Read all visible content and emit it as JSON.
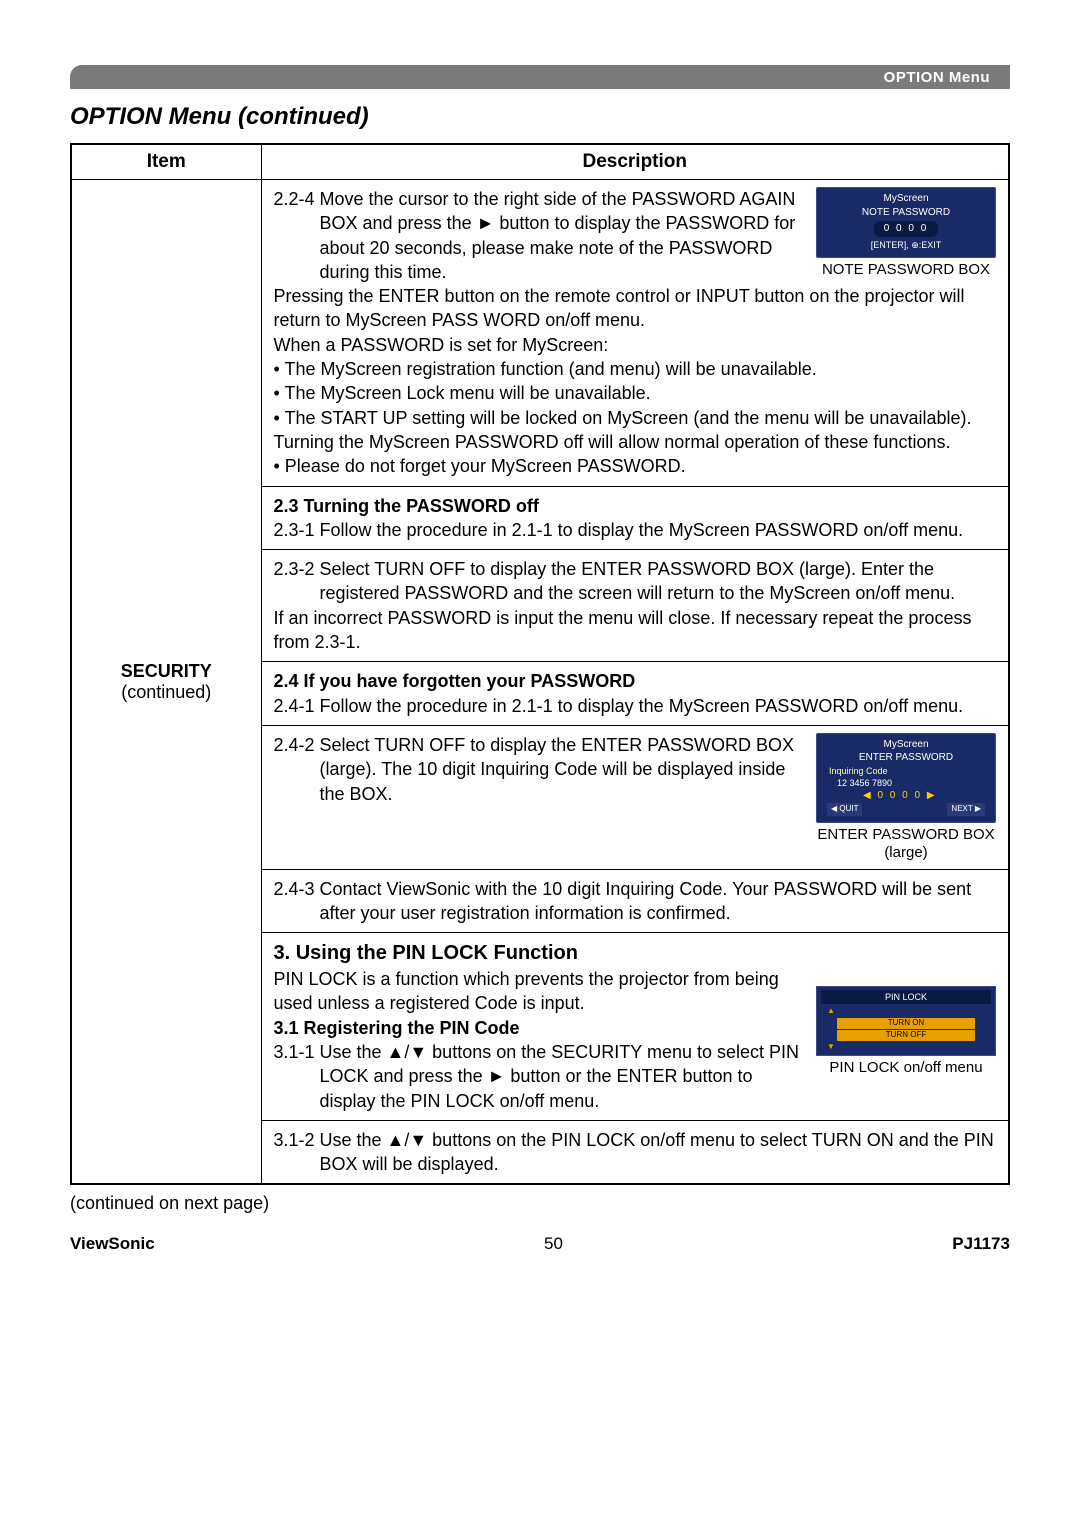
{
  "header": {
    "menu_label": "OPTION Menu"
  },
  "title": "OPTION Menu (continued)",
  "table": {
    "col_item": "Item",
    "col_desc": "Description",
    "item_label": "SECURITY",
    "item_sub": "(continued)"
  },
  "osd1": {
    "t1": "MyScreen",
    "t2": "NOTE PASSWORD",
    "digits": "0 0 0 0",
    "bot": "[ENTER], ⊕:EXIT",
    "caption": "NOTE PASSWORD BOX"
  },
  "osd2": {
    "t1": "MyScreen",
    "t2": "ENTER PASSWORD",
    "ic": "Inquiring Code",
    "ic2": "12 3456 7890",
    "digits": "◀ 0 0 0 0 ▶",
    "q": "◀ QUIT",
    "n": "NEXT ▶",
    "caption": "ENTER PASSWORD BOX (large)"
  },
  "osd3": {
    "hd": "PIN LOCK",
    "on": "TURN ON",
    "off": "TURN OFF",
    "caption": "PIN LOCK on/off menu"
  },
  "sec1": {
    "p1a": "2.2-4 ",
    "p1b": "Move the cursor to the right side of the PASSWORD AGAIN BOX and press the ► button to display the PASSWORD for about 20 seconds, please make note of the PASSWORD during this time.",
    "p2": "Pressing the ENTER button on the remote control or INPUT button on the projector will return to MyScreen PASS WORD on/off menu.",
    "p3": "When a PASSWORD is set for MyScreen:",
    "b1": "• The MyScreen registration function (and menu) will be unavailable.",
    "b2": "• The MyScreen Lock menu will be unavailable.",
    "b3": "• The START UP setting will be locked on MyScreen (and the menu will be unavailable).",
    "p4": "Turning the MyScreen PASSWORD off will allow normal operation of these functions.",
    "b4": "• Please do not forget your MyScreen PASSWORD."
  },
  "sec2": {
    "h": "2.3 Turning the PASSWORD off",
    "n1": "2.3-1 ",
    "t1": "Follow the procedure in 2.1-1 to display the MyScreen PASSWORD on/off menu."
  },
  "sec3": {
    "n1": "2.3-2 ",
    "t1": "Select TURN OFF to display the ENTER PASSWORD BOX (large). Enter the registered PASSWORD and the screen will return to the MyScreen on/off menu.",
    "p2": "If an incorrect PASSWORD is input the menu will close. If necessary repeat the process from 2.3-1."
  },
  "sec4": {
    "h": "2.4 If you have forgotten your PASSWORD",
    "n1": "2.4-1 ",
    "t1": "Follow the procedure in 2.1-1 to display the MyScreen PASSWORD on/off menu."
  },
  "sec5": {
    "n1": "2.4-2 ",
    "t1": "Select TURN OFF to display the ENTER PASSWORD BOX (large). The 10 digit Inquiring Code will be displayed inside the BOX."
  },
  "sec6": {
    "n1": "2.4-3 ",
    "t1": "Contact ViewSonic with the 10 digit Inquiring Code. Your PASSWORD will be sent after your user registration information is confirmed."
  },
  "sec7": {
    "h": "3. Using the PIN LOCK Function",
    "p1": "PIN LOCK is a function which prevents the projector from being used unless a registered Code is input.",
    "h2": "3.1 Registering the PIN Code",
    "n1": "3.1-1 ",
    "t1": "Use the ▲/▼ buttons on the SECURITY menu to select PIN LOCK and press the ► button or the ENTER button to display the PIN LOCK on/off menu."
  },
  "sec8": {
    "n1": "3.1-2 ",
    "t1": "Use the ▲/▼ buttons on the PIN LOCK on/off menu to select TURN ON and the PIN BOX will be displayed."
  },
  "cont": "(continued on next page)",
  "footer": {
    "brand": "ViewSonic",
    "page": "50",
    "model": "PJ1173"
  }
}
